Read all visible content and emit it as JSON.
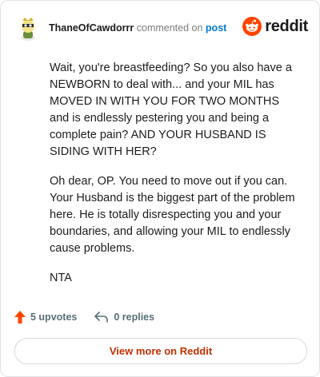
{
  "comment": {
    "author": "ThaneOfCawdorrr",
    "action_text": "commented on",
    "post_link_text": "post",
    "paragraphs": [
      "Wait, you're breastfeeding? So you also have a NEWBORN to deal with... and your MIL has MOVED IN WITH YOU FOR TWO MONTHS and is endlessly pestering you and being a complete pain? AND YOUR HUSBAND IS SIDING WITH HER?",
      "Oh dear, OP. You need to move out if you can. Your Husband is the biggest part of the problem here. He is totally disrespecting you and your boundaries, and allowing your MIL to endlessly cause problems.",
      "NTA"
    ]
  },
  "brand": {
    "word": "reddit",
    "icon": "reddit-snoo-icon",
    "color": "#ff4500"
  },
  "footer": {
    "upvotes_label": "5 upvotes",
    "replies_label": "0 replies",
    "upvote_icon": "upvote-arrow-icon",
    "reply_icon": "reply-arrow-icon",
    "upvote_color": "#ff4500"
  },
  "view_more_label": "View more on Reddit",
  "accent_link_color": "#0079d3",
  "view_more_color": "#c53000"
}
